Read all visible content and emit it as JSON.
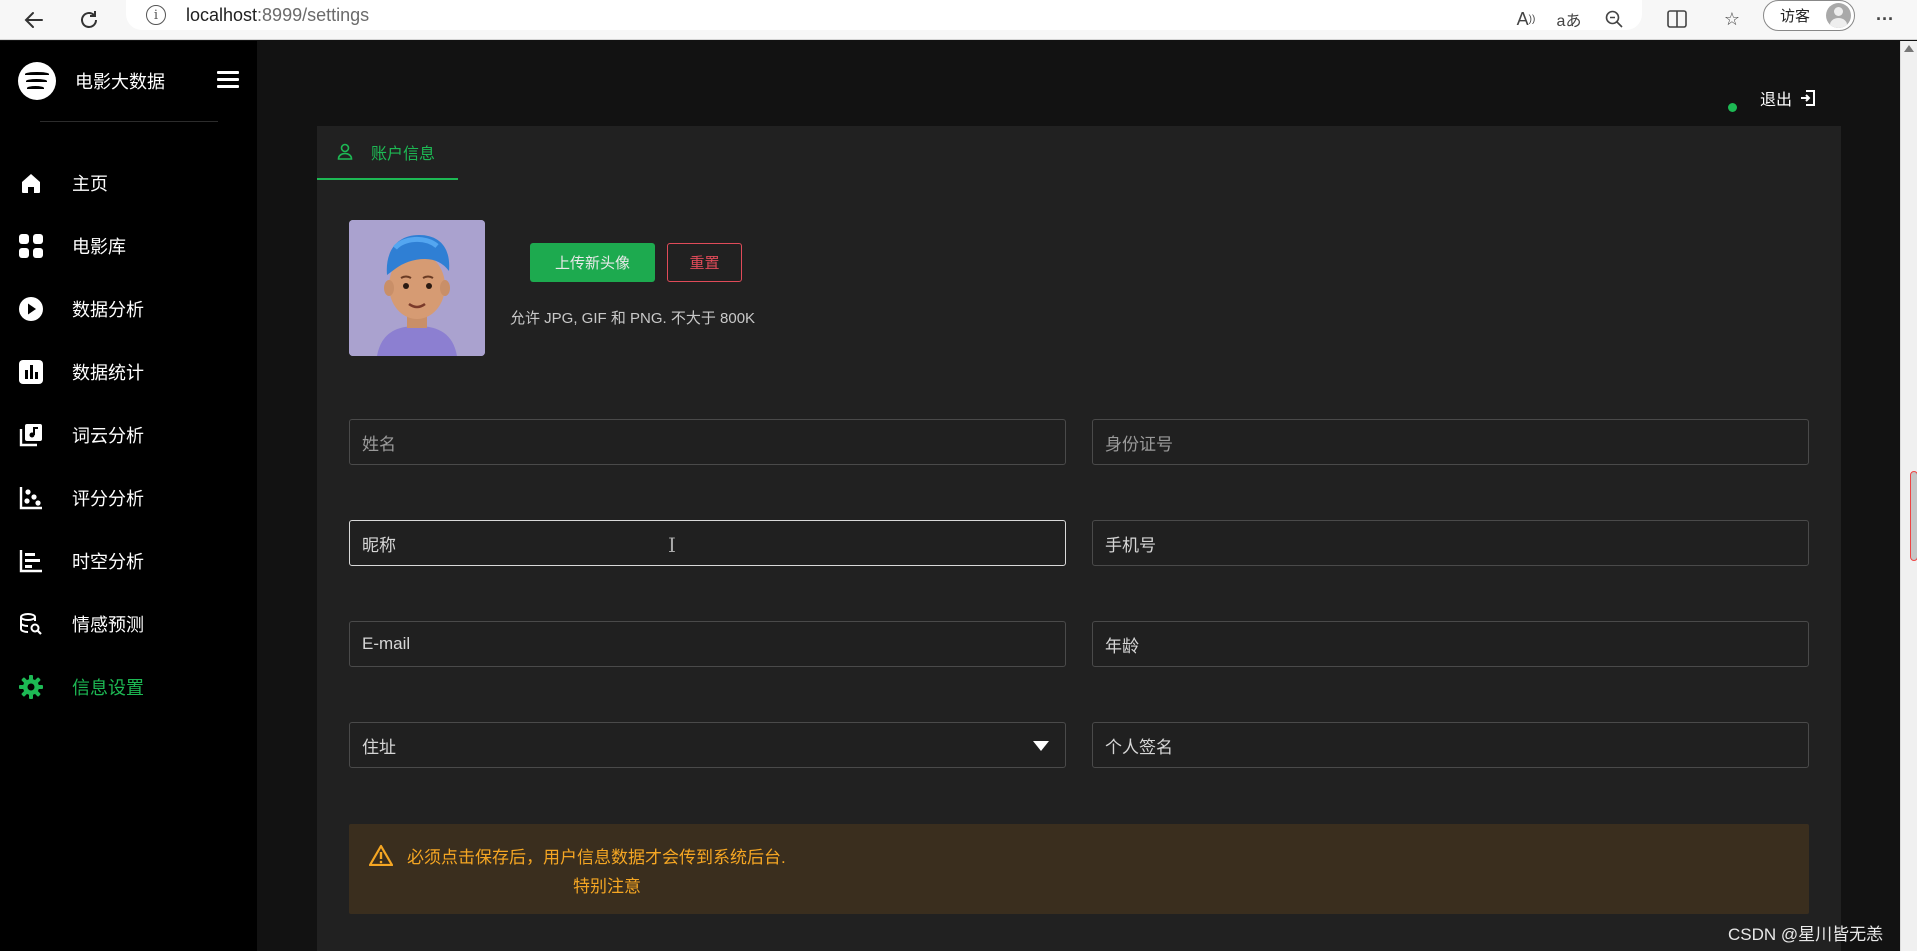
{
  "browser": {
    "url_host": "localhost",
    "url_rest": ":8999/settings",
    "guest_label": "访客"
  },
  "sidebar": {
    "brand": "电影大数据",
    "items": [
      {
        "label": "主页",
        "icon": "home-icon"
      },
      {
        "label": "电影库",
        "icon": "grid-icon"
      },
      {
        "label": "数据分析",
        "icon": "play-circle-icon"
      },
      {
        "label": "数据统计",
        "icon": "bar-chart-icon"
      },
      {
        "label": "词云分析",
        "icon": "music-library-icon"
      },
      {
        "label": "评分分析",
        "icon": "scatter-icon"
      },
      {
        "label": "时空分析",
        "icon": "timeline-icon"
      },
      {
        "label": "情感预测",
        "icon": "search-data-icon"
      },
      {
        "label": "信息设置",
        "icon": "gear-icon",
        "active": true
      }
    ]
  },
  "header": {
    "logout_label": "退出"
  },
  "account": {
    "tab_label": "账户信息",
    "upload_label": "上传新头像",
    "reset_label": "重置",
    "hint": "允许 JPG, GIF 和 PNG. 不大于 800K"
  },
  "form": {
    "name": "姓名",
    "id_number": "身份证号",
    "nickname": "昵称",
    "phone": "手机号",
    "email": "E-mail",
    "age": "年龄",
    "address": "住址",
    "signature": "个人签名"
  },
  "alert": {
    "message": "必须点击保存后，用户信息数据才会传到系统后台.",
    "sub": "特别注意"
  },
  "watermark": "CSDN @星川皆无恙",
  "colors": {
    "accent": "#1db954",
    "danger": "#e04b59",
    "warning": "#f5a623",
    "background": "#121212"
  }
}
